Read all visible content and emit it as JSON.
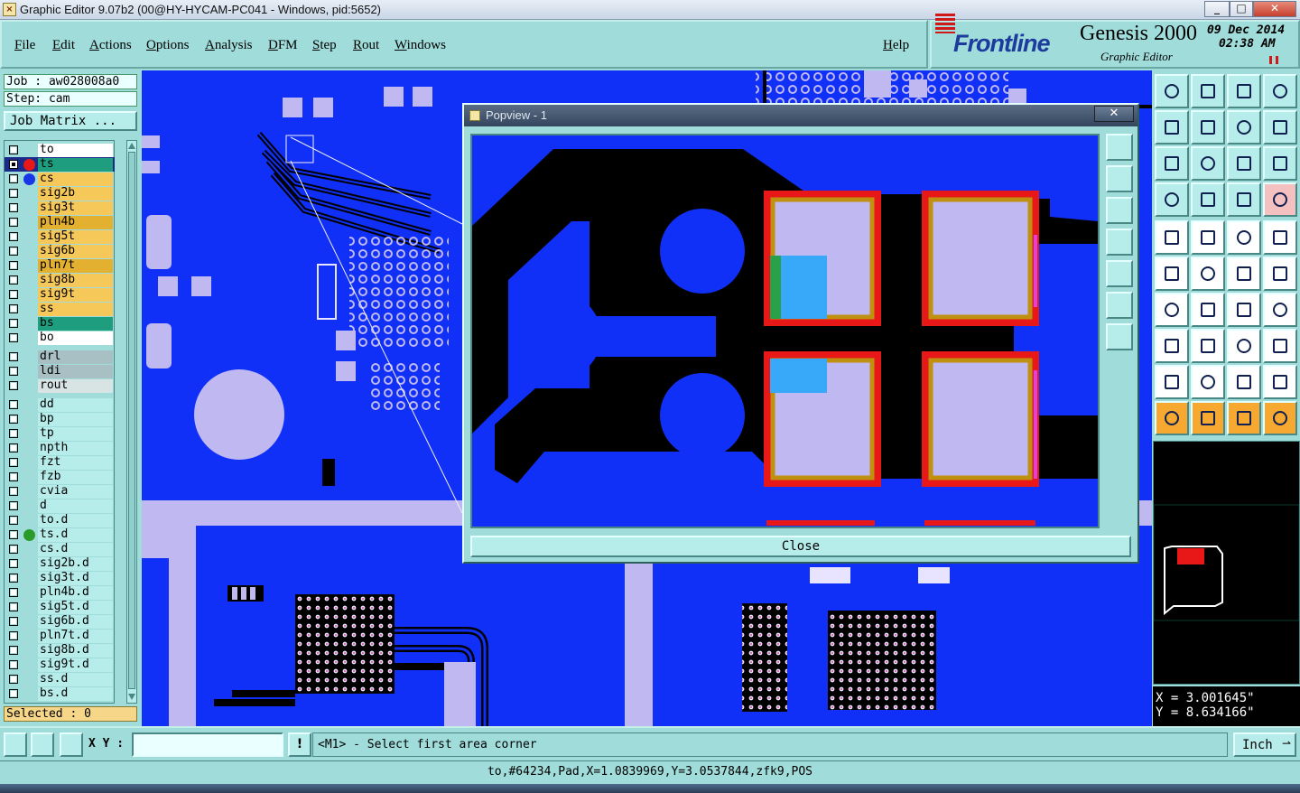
{
  "window": {
    "title": "Graphic Editor 9.07b2 (00@HY-HYCAM-PC041 - Windows, pid:5652)",
    "minimize": "_",
    "maximize": "□",
    "close": "✕"
  },
  "menu": [
    "File",
    "Edit",
    "Actions",
    "Options",
    "Analysis",
    "DFM",
    "Step",
    "Rout",
    "Windows"
  ],
  "help": "Help",
  "brand": {
    "logo": "Frontline",
    "product": "Genesis 2000",
    "subtitle": "Graphic Editor",
    "date": "09 Dec 2014",
    "time": "02:38 AM"
  },
  "job": {
    "job_line": "Job : aw028008a0",
    "step_line": "Step: cam",
    "matrix_button": "Job Matrix ..."
  },
  "layers": [
    {
      "name": "to",
      "bg": "#ffffff",
      "dot": "",
      "pen": true
    },
    {
      "name": "ts",
      "bg": "#1e9e7e",
      "dot": "#e81818",
      "pen": true,
      "active": true
    },
    {
      "name": "cs",
      "bg": "#f6c85a",
      "dot": "#1838e8",
      "pen": true
    },
    {
      "name": "sig2b",
      "bg": "#f6c85a",
      "dot": "",
      "pen": true
    },
    {
      "name": "sig3t",
      "bg": "#f6c85a",
      "dot": "",
      "pen": true
    },
    {
      "name": "pln4b",
      "bg": "#e4b030",
      "dot": "",
      "pen": true
    },
    {
      "name": "sig5t",
      "bg": "#f6c85a",
      "dot": "",
      "pen": true
    },
    {
      "name": "sig6b",
      "bg": "#f6c85a",
      "dot": "",
      "pen": true
    },
    {
      "name": "pln7t",
      "bg": "#e4b030",
      "dot": "",
      "pen": true
    },
    {
      "name": "sig8b",
      "bg": "#f6c85a",
      "dot": "",
      "pen": true
    },
    {
      "name": "sig9t",
      "bg": "#f6c85a",
      "dot": "",
      "pen": true
    },
    {
      "name": "ss",
      "bg": "#f6c85a",
      "dot": "",
      "pen": true
    },
    {
      "name": "bs",
      "bg": "#1e9e7e",
      "dot": "",
      "pen": true
    },
    {
      "name": "bo",
      "bg": "#ffffff",
      "dot": "",
      "pen": true
    },
    {
      "name": "drl",
      "bg": "#a8c0c4",
      "dot": "",
      "pen": false
    },
    {
      "name": "ldi",
      "bg": "#a8c0c4",
      "dot": "",
      "pen": false
    },
    {
      "name": "rout",
      "bg": "#d8e4e4",
      "dot": "",
      "pen": false
    },
    {
      "name": "dd",
      "bg": "#b6ecea",
      "dot": "",
      "pen": true
    },
    {
      "name": "bp",
      "bg": "#b6ecea",
      "dot": "",
      "pen": false
    },
    {
      "name": "tp",
      "bg": "#b6ecea",
      "dot": "",
      "pen": false
    },
    {
      "name": "npth",
      "bg": "#b6ecea",
      "dot": "",
      "pen": false
    },
    {
      "name": "fzt",
      "bg": "#b6ecea",
      "dot": "",
      "pen": false
    },
    {
      "name": "fzb",
      "bg": "#b6ecea",
      "dot": "",
      "pen": false
    },
    {
      "name": "cvia",
      "bg": "#b6ecea",
      "dot": "",
      "pen": false
    },
    {
      "name": "d",
      "bg": "#b6ecea",
      "dot": "",
      "pen": false
    },
    {
      "name": "to.d",
      "bg": "#b6ecea",
      "dot": "",
      "pen": true
    },
    {
      "name": "ts.d",
      "bg": "#b6ecea",
      "dot": "#2a9a2a",
      "pen": true
    },
    {
      "name": "cs.d",
      "bg": "#b6ecea",
      "dot": "",
      "pen": true
    },
    {
      "name": "sig2b.d",
      "bg": "#b6ecea",
      "dot": "",
      "pen": true
    },
    {
      "name": "sig3t.d",
      "bg": "#b6ecea",
      "dot": "",
      "pen": true
    },
    {
      "name": "pln4b.d",
      "bg": "#b6ecea",
      "dot": "",
      "pen": true
    },
    {
      "name": "sig5t.d",
      "bg": "#b6ecea",
      "dot": "",
      "pen": true
    },
    {
      "name": "sig6b.d",
      "bg": "#b6ecea",
      "dot": "",
      "pen": true
    },
    {
      "name": "pln7t.d",
      "bg": "#b6ecea",
      "dot": "",
      "pen": true
    },
    {
      "name": "sig8b.d",
      "bg": "#b6ecea",
      "dot": "",
      "pen": true
    },
    {
      "name": "sig9t.d",
      "bg": "#b6ecea",
      "dot": "",
      "pen": true
    },
    {
      "name": "ss.d",
      "bg": "#b6ecea",
      "dot": "",
      "pen": true
    },
    {
      "name": "bs.d",
      "bg": "#b6ecea",
      "dot": "",
      "pen": true
    }
  ],
  "selected": "Selected : 0",
  "popview": {
    "title": "Popview - 1",
    "close_button": "Close",
    "close_x": "✕"
  },
  "coords": {
    "x": "X = 3.001645\"",
    "y": "Y = 8.634166\""
  },
  "bottom": {
    "xy_label": "X Y :",
    "xy_value": "",
    "prompt_icon": "!",
    "prompt": "<M1> - Select first area corner",
    "units": "Inch"
  },
  "status": "to,#64234,Pad,X=1.0839969,Y=3.0537844,zfk9,POS",
  "colors": {
    "panel": "#9fdcda",
    "canvas_bg": "#1030f8",
    "copper": "#c0b8f0",
    "outline_red": "#e81818",
    "accent_orange": "#f6a830"
  }
}
